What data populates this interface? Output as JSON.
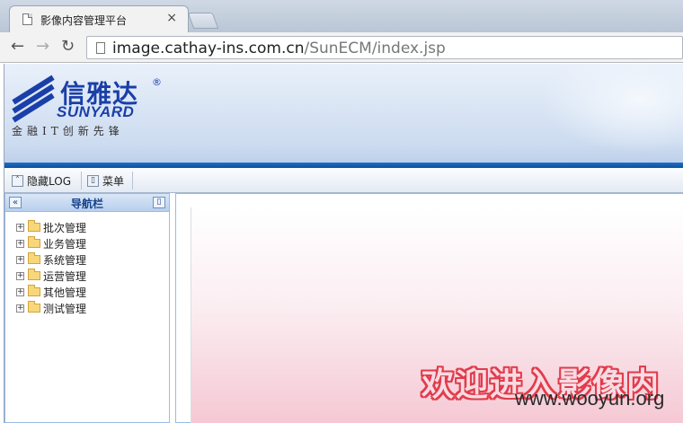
{
  "browser": {
    "tab_title": "影像内容管理平台",
    "tab_close": "×",
    "url_host": "image.cathay-ins.com.cn",
    "url_path": "/SunECM/index.jsp"
  },
  "header": {
    "logo_cn": "信雅达",
    "logo_reg": "®",
    "logo_en": "SUNYARD",
    "slogan": "金融IT创新先锋"
  },
  "menubar": {
    "items": [
      {
        "label": "隐藏LOG",
        "icon": "double-up-icon"
      },
      {
        "label": "菜单",
        "icon": "pin-icon"
      }
    ]
  },
  "sidebar": {
    "title": "导航栏",
    "items": [
      {
        "label": "批次管理"
      },
      {
        "label": "业务管理"
      },
      {
        "label": "系统管理"
      },
      {
        "label": "运营管理"
      },
      {
        "label": "其他管理"
      },
      {
        "label": "测试管理"
      }
    ]
  },
  "main": {
    "welcome": "欢迎进入影像内",
    "watermark": "www.wooyun.org"
  }
}
